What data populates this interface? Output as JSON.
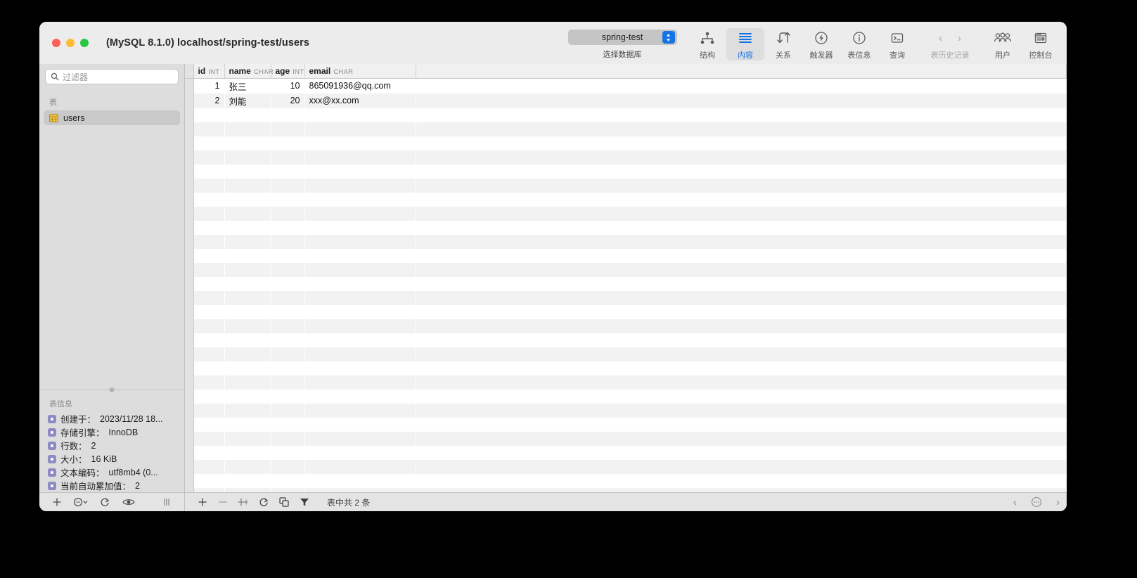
{
  "window": {
    "title": "(MySQL 8.1.0) localhost/spring-test/users",
    "traffic_lights": [
      "close",
      "minimize",
      "zoom"
    ]
  },
  "toolbar": {
    "database": {
      "value": "spring-test",
      "caption": "选择数据库",
      "icon": "stepper-updown-icon",
      "accent": "#1473e6"
    },
    "items": [
      {
        "label": "结构",
        "icon": "structure-icon",
        "active": false
      },
      {
        "label": "内容",
        "icon": "content-lines-icon",
        "active": true
      },
      {
        "label": "关系",
        "icon": "relations-icon",
        "active": false
      },
      {
        "label": "触发器",
        "icon": "trigger-bolt-icon",
        "active": false
      },
      {
        "label": "表信息",
        "icon": "info-circle-icon",
        "active": false
      },
      {
        "label": "查询",
        "icon": "terminal-icon",
        "active": false
      }
    ],
    "history": {
      "label": "表历史记录",
      "back": "‹",
      "forward": "›"
    },
    "right_items": [
      {
        "label": "用户",
        "icon": "users-icon"
      },
      {
        "label": "控制台",
        "icon": "console-icon"
      }
    ]
  },
  "sidebar": {
    "filter": {
      "placeholder": "过滤器",
      "value": "",
      "icon": "search-icon"
    },
    "tables_header": "表",
    "tables": [
      {
        "name": "users",
        "icon": "table-icon",
        "selected": true
      }
    ],
    "info_header": "表信息",
    "info_rows": [
      {
        "label": "创建于：",
        "value": "2023/11/28 18..."
      },
      {
        "label": "存储引擎：",
        "value": "InnoDB"
      },
      {
        "label": "行数：",
        "value": "2"
      },
      {
        "label": "大小：",
        "value": "16 KiB"
      },
      {
        "label": "文本编码：",
        "value": "utf8mb4 (0..."
      },
      {
        "label": "当前自动累加值：",
        "value": "2"
      }
    ],
    "bottom_buttons": [
      {
        "icon": "plus-icon",
        "label": "+"
      },
      {
        "icon": "more-menu-icon",
        "label": "⋯"
      },
      {
        "icon": "refresh-icon",
        "label": "↻"
      },
      {
        "icon": "eye-icon",
        "label": "◉"
      },
      {
        "icon": "resize-handle-icon",
        "label": "|||"
      }
    ]
  },
  "grid": {
    "columns": [
      {
        "name": "id",
        "type": "INT"
      },
      {
        "name": "name",
        "type": "CHAR"
      },
      {
        "name": "age",
        "type": "INT"
      },
      {
        "name": "email",
        "type": "CHAR"
      }
    ],
    "rows": [
      {
        "id": "1",
        "name": "张三",
        "age": "10",
        "email": "865091936@qq.com"
      },
      {
        "id": "2",
        "name": "刘能",
        "age": "20",
        "email": "xxx@xx.com"
      }
    ],
    "empty_row_count": 28
  },
  "content_bottombar": {
    "buttons": [
      {
        "icon": "add-row-icon",
        "label": "+"
      },
      {
        "icon": "remove-row-icon",
        "label": "−"
      },
      {
        "icon": "duplicate-row-icon",
        "label": "⊹"
      },
      {
        "icon": "refresh-icon",
        "label": "↻"
      },
      {
        "icon": "copy-icon",
        "label": "❏"
      },
      {
        "icon": "filter-funnel-icon",
        "label": "▼"
      }
    ],
    "status": "表中共 2 条",
    "pager": {
      "prev": "‹",
      "more": "⋯",
      "next": "›"
    }
  }
}
